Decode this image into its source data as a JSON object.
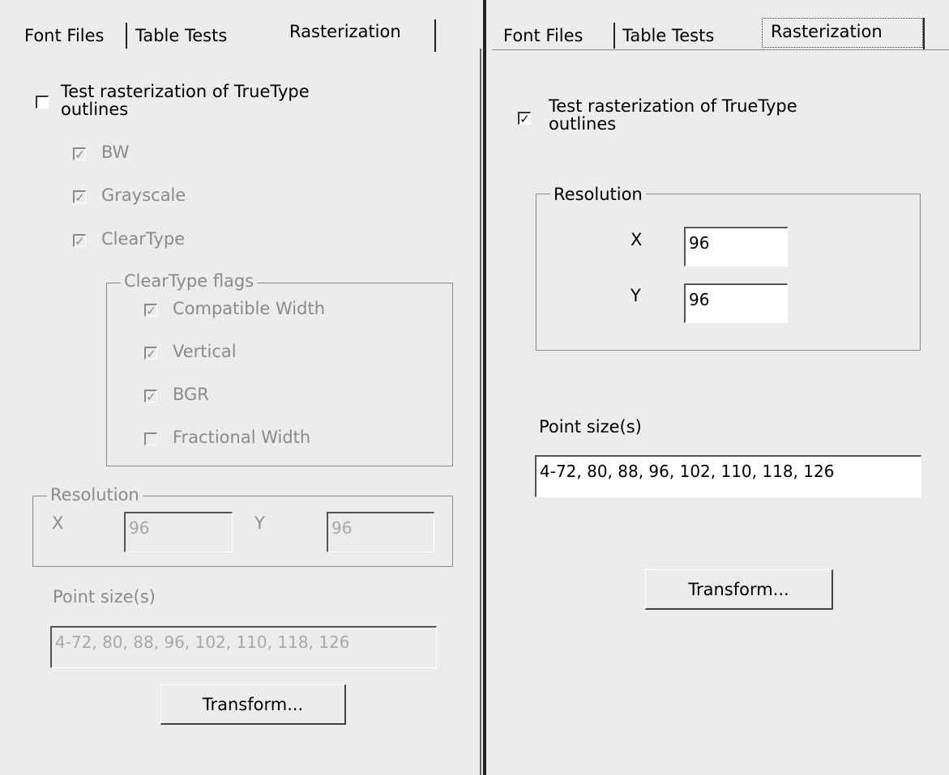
{
  "tabs": [
    "Font Files",
    "Table Tests",
    "Rasterization"
  ],
  "left": {
    "test_rasterization_label": [
      "Test rasterization of TrueType",
      "outlines"
    ],
    "test_rasterization_checked": false,
    "bw_label": "BW",
    "grayscale_label": "Grayscale",
    "cleartype_label": "ClearType",
    "cleartype_flags_title": "ClearType flags",
    "flags": {
      "compatible_width": "Compatible Width",
      "vertical": "Vertical",
      "bgr": "BGR",
      "fractional_width": "Fractional Width"
    },
    "resolution_title": "Resolution",
    "x_label": "X",
    "x_value": "96",
    "y_label": "Y",
    "y_value": "96",
    "point_sizes_label": "Point size(s)",
    "point_sizes_value": "4-72, 80, 88, 96, 102, 110, 118, 126",
    "transform_button": "Transform..."
  },
  "right": {
    "test_rasterization_label": [
      "Test rasterization of TrueType",
      "outlines"
    ],
    "test_rasterization_checked": true,
    "resolution_title": "Resolution",
    "x_label": "X",
    "x_value": "96",
    "y_label": "Y",
    "y_value": "96",
    "point_sizes_label": "Point size(s)",
    "point_sizes_value": "4-72, 80, 88, 96, 102, 110, 118, 126",
    "transform_button": "Transform..."
  },
  "glyphs": {
    "check": "✓"
  }
}
